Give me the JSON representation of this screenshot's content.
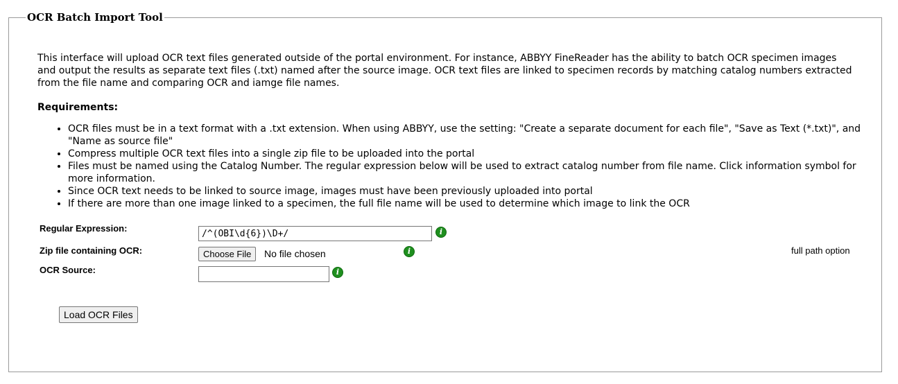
{
  "form": {
    "legend": "OCR Batch Import Tool",
    "intro": "This interface will upload OCR text files generated outside of the portal environment. For instance, ABBYY FineReader has the ability to batch OCR specimen images and output the results as separate text files (.txt) named after the source image. OCR text files are linked to specimen records by matching catalog numbers extracted from the file name and comparing OCR and iamge file names.",
    "requirements_heading": "Requirements:",
    "requirements": [
      "OCR files must be in a text format with a .txt extension. When using ABBYY, use the setting: \"Create a separate document for each file\", \"Save as Text (*.txt)\", and \"Name as source file\"",
      "Compress multiple OCR text files into a single zip file to be uploaded into the portal",
      "Files must be named using the Catalog Number. The regular expression below will be used to extract catalog number from file name. Click information symbol for more information.",
      "Since OCR text needs to be linked to source image, images must have been previously uploaded into portal",
      "If there are more than one image linked to a specimen, the full file name will be used to determine which image to link the OCR"
    ],
    "regex": {
      "label": "Regular Expression:",
      "value": "/^(OBI\\d{6})\\D+/"
    },
    "zip": {
      "label": "Zip file containing OCR:",
      "choose_label": "Choose File",
      "status": "No file chosen",
      "full_path_option": "full path option"
    },
    "source": {
      "label": "OCR Source:",
      "value": ""
    },
    "info_icon_glyph": "i",
    "submit_label": "Load OCR Files"
  },
  "colors": {
    "info_icon": "#1f8f1f",
    "fieldset_border": "#9a9a9a",
    "button_bg": "#efefef"
  }
}
